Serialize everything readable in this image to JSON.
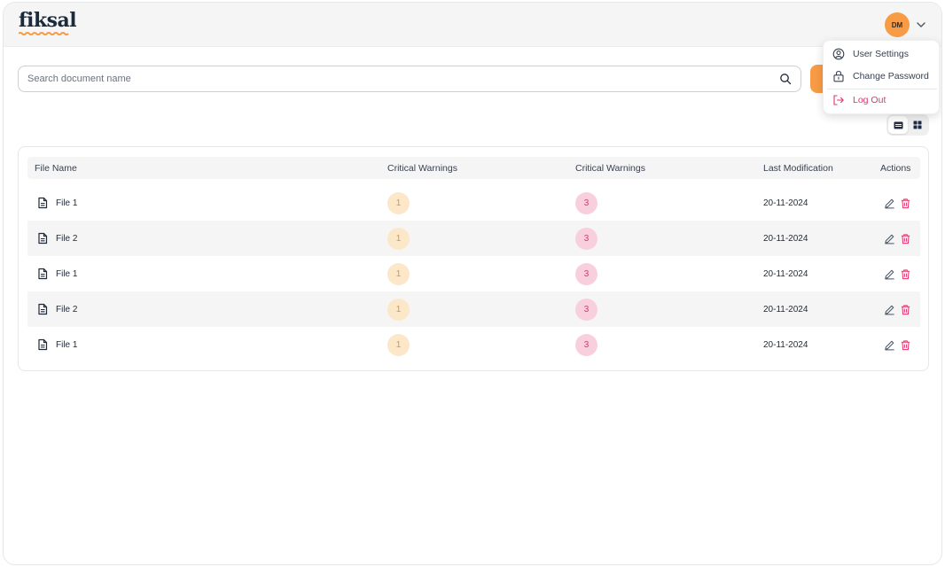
{
  "app": {
    "logo_text": "fiksal",
    "brand_color": "#f89b45",
    "danger_color": "#e0356a"
  },
  "user": {
    "initials": "DM"
  },
  "user_menu": {
    "items": [
      {
        "label": "User Settings",
        "icon": "user-circle-icon"
      },
      {
        "label": "Change Password",
        "icon": "lock-icon"
      },
      {
        "label": "Log Out",
        "icon": "logout-icon"
      }
    ]
  },
  "search": {
    "placeholder": "Search document name",
    "value": ""
  },
  "view_toggle": {
    "selected": "list",
    "options": [
      "list",
      "grid"
    ]
  },
  "table": {
    "columns": [
      "File Name",
      "Critical Warnings",
      "Critical Warnings",
      "Last Modification",
      "Actions"
    ],
    "rows": [
      {
        "name": "File 1",
        "warn_a": "1",
        "warn_b": "3",
        "modified": "20-11-2024"
      },
      {
        "name": "File 2",
        "warn_a": "1",
        "warn_b": "3",
        "modified": "20-11-2024"
      },
      {
        "name": "File 1",
        "warn_a": "1",
        "warn_b": "3",
        "modified": "20-11-2024"
      },
      {
        "name": "File 2",
        "warn_a": "1",
        "warn_b": "3",
        "modified": "20-11-2024"
      },
      {
        "name": "File 1",
        "warn_a": "1",
        "warn_b": "3",
        "modified": "20-11-2024"
      }
    ]
  }
}
